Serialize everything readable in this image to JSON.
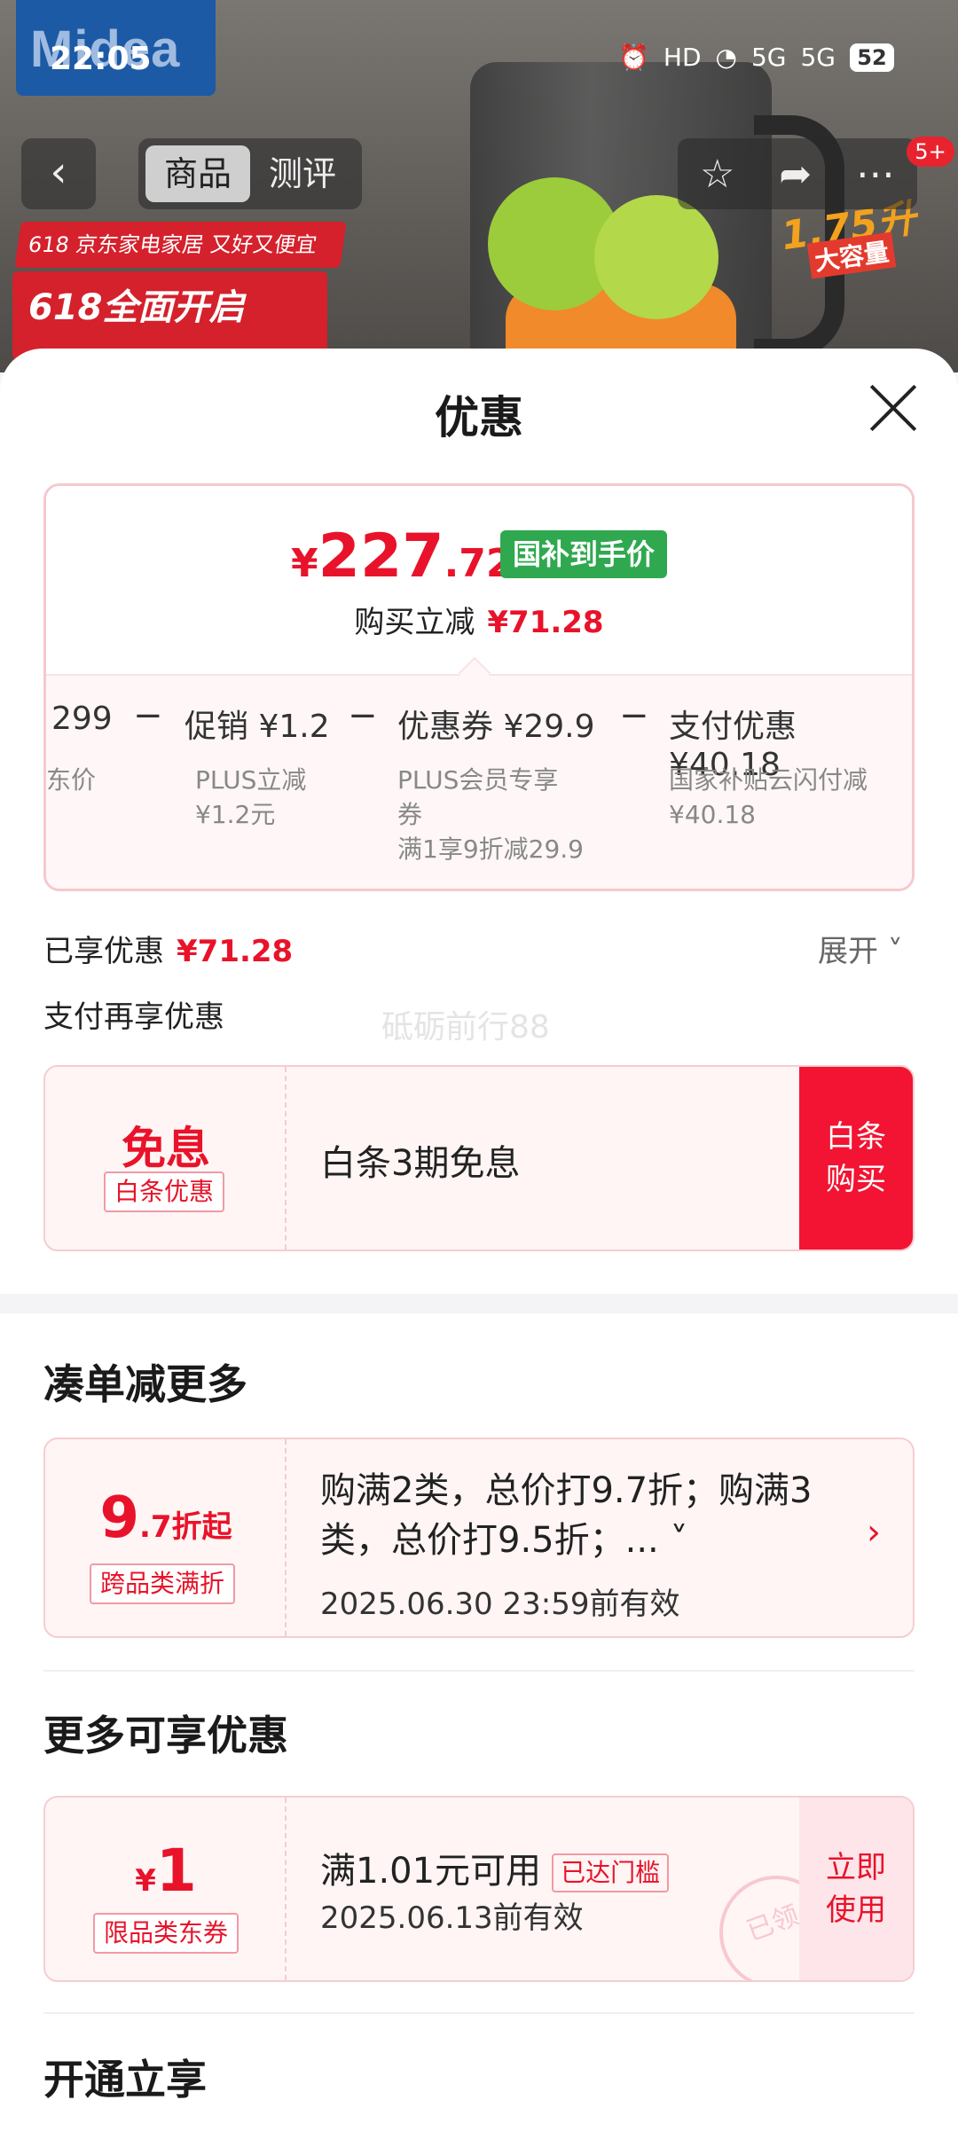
{
  "status_bar": {
    "time": "22:05",
    "hd": "HD",
    "net1": "5G",
    "net2": "5G",
    "battery": "52"
  },
  "background": {
    "brand": "Midea",
    "promo_line1": "618 京东家电家居 又好又便宜",
    "promo_line2": "618全面开启",
    "capacity": "1.75升",
    "capacity_sub": "大容量"
  },
  "nav": {
    "back": "‹",
    "tabs": [
      "商品",
      "测评"
    ],
    "badge": "5+"
  },
  "sheet": {
    "title": "优惠",
    "price": {
      "currency": "¥",
      "integer": "227",
      "decimal": ".72",
      "tag": "国补到手价",
      "save_label": "购买立减",
      "save_amount": "¥71.28"
    },
    "breakdown": [
      {
        "title": "299",
        "sub": [
          "东价"
        ]
      },
      {
        "title": "促销 ¥1.2",
        "sub": [
          "PLUS立减",
          "¥1.2元"
        ]
      },
      {
        "title": "优惠券 ¥29.9",
        "sub": [
          "PLUS会员专享",
          "券",
          "满1享9折减29.9"
        ]
      },
      {
        "title": "支付优惠 ¥40.18",
        "sub": [
          "国家补贴云闪付减",
          "¥40.18"
        ]
      }
    ],
    "minus": "−",
    "enjoyed_label": "已享优惠",
    "enjoyed_amount": "¥71.28",
    "expand": "展开",
    "pay_more": "支付再享优惠",
    "watermark": "砥砺前行88",
    "baitiao": {
      "big": "免息",
      "badge": "白条优惠",
      "text": "白条3期免息",
      "button_line1": "白条",
      "button_line2": "购买"
    },
    "section_more": "凑单减更多",
    "bundle": {
      "big_int": "9",
      "big_rest": ".7折起",
      "badge": "跨品类满折",
      "text_line1": "购满2类，总价打9.7折；购满3",
      "text_line2": "类，总价打9.5折；...",
      "date": "2025.06.30 23:59前有效",
      "chev": "›"
    },
    "section_available": "更多可享优惠",
    "coupon": {
      "cur": "¥",
      "amount": "1",
      "badge": "限品类东券",
      "text": "满1.01元可用",
      "reached": "已达门槛",
      "date": "2025.06.13前有效",
      "button_line1": "立即",
      "button_line2": "使用",
      "stamp": "已领"
    },
    "section_open": "开通立享"
  }
}
